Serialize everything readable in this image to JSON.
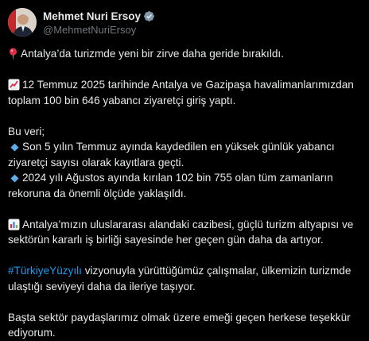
{
  "author": {
    "display_name": "Mehmet Nuri Ersoy",
    "handle": "@MehmetNuriErsoy",
    "verified_icon": "verified-badge-gray"
  },
  "post": {
    "headline": "Antalya’da turizmde yeni bir zirve daha geride bırakıldı.",
    "para1": [
      "12 Temmuz 2025 tarihinde Antalya ve Gazipaşa havalimanlarımızdan",
      "toplam 100 bin 646 yabancı ziyaretçi giriş yaptı."
    ],
    "para2_intro": "Bu veri;",
    "bullet1": [
      "Son 5 yılın Temmuz ayında kaydedilen en yüksek günlük yabancı",
      "ziyaretçi sayısı olarak kayıtlara geçti."
    ],
    "bullet2": [
      "2024 yılı Ağustos ayında kırılan 102 bin 755 olan tüm zamanların",
      "rekoruna da önemli ölçüde yaklaşıldı."
    ],
    "para3": [
      "Antalya’mızın uluslararası alandaki cazibesi, güçlü turizm altyapısı ve",
      "sektörün kararlı iş birliği sayesinde her geçen gün daha da artıyor."
    ],
    "hashtag": "#TürkiyeYüzyılı",
    "para4_rest": " vizyonuyla yürüttüğümüz çalışmalar, ülkemizin turizmde",
    "para4_line2": "ulaştığı seviyeyi daha da ileriye taşıyor.",
    "para5": [
      "Başta sektör paydaşlarımız olmak üzere emeği geçen herkese teşekkür",
      "ediyorum."
    ]
  },
  "icons": {
    "pin": "round-pushpin-icon",
    "trend": "chart-increasing-icon",
    "diamond": "small-blue-diamond-icon",
    "bar": "bar-chart-icon"
  },
  "colors": {
    "background": "#000000",
    "text": "#e7e9ea",
    "secondary": "#71767b",
    "link": "#1d9bf0"
  }
}
